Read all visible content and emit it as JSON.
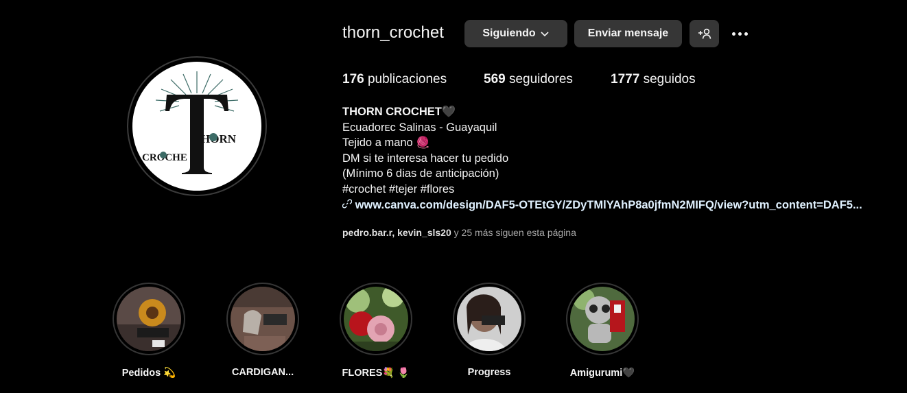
{
  "profile": {
    "username": "thorn_crochet",
    "avatar_logo": {
      "letter": "T",
      "word_top": "HORN",
      "word_left": "CROCHE"
    },
    "buttons": {
      "following_label": "Siguiendo",
      "message_label": "Enviar mensaje",
      "suggest_icon": "add-person-icon",
      "more_icon": "more-options-icon"
    },
    "stats": {
      "posts_count": "176",
      "posts_label": "publicaciones",
      "followers_count": "569",
      "followers_label": "seguidores",
      "following_count": "1777",
      "following_label": "seguidos"
    },
    "bio": {
      "name": "THORN CROCHET🖤",
      "lines": [
        "Ecuadorᴇᴄ Salinas - Guayaquil",
        "Tejido a mano 🧶",
        "DM si te interesa hacer tu pedido",
        "(Mínimo 6 dias de anticipación)",
        "#crochet #tejer #flores"
      ],
      "link": "www.canva.com/design/DAF5-OTEtGY/ZDyTMlYAhP8a0jfmN2MIFQ/view?utm_content=DAF5..."
    },
    "followed_by": {
      "names": "pedro.bar.r, kevin_sls20",
      "suffix": " y 25 más siguen esta página"
    }
  },
  "highlights": [
    {
      "label": "Pedidos 💫"
    },
    {
      "label": "CARDIGAN..."
    },
    {
      "label": "FLORES💐 🌷"
    },
    {
      "label": "Progress"
    },
    {
      "label": "Amigurumi🖤"
    }
  ],
  "colors": {
    "background": "#000000",
    "button_bg": "#363636",
    "text_primary": "#f5f5f5",
    "text_secondary": "#a8a8a8",
    "link": "#e0f1ff",
    "logo_teal": "#3c6b66"
  }
}
